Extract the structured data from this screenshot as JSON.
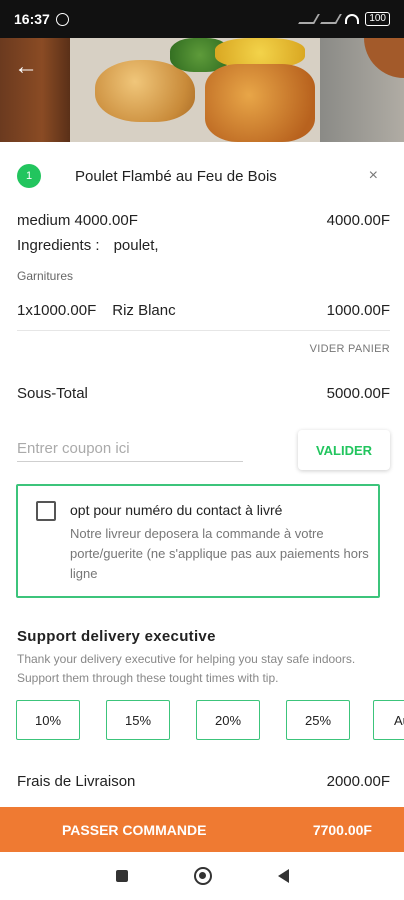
{
  "status_bar": {
    "time": "16:37",
    "battery": "100"
  },
  "cart": {
    "item_index": "1",
    "item_title": "Poulet Flambé au Feu de Bois",
    "size_line": "medium 4000.00F",
    "size_price": "4000.00F",
    "ingredients_label": "Ingredients :",
    "ingredients_value": "poulet,",
    "garnish_header": "Garnitures",
    "garnish_qty_price": "1x1000.00F",
    "garnish_name": "Riz Blanc",
    "garnish_price": "1000.00F",
    "empty_cart_label": "VIDER PANIER",
    "subtotal_label": "Sous-Total",
    "subtotal_value": "5000.00F"
  },
  "coupon": {
    "placeholder": "Entrer coupon ici",
    "validate_label": "VALIDER"
  },
  "contact_option": {
    "checked": false,
    "title": "opt pour numéro du contact à livré",
    "description": "Notre livreur deposera la commande à votre porte/guerite (ne s'applique pas aux paiements hors ligne"
  },
  "support": {
    "title": "Support delivery executive",
    "description": "Thank your delivery executive for helping you stay safe indoors. Support them through these tought times with tip.",
    "tips": [
      "10%",
      "15%",
      "20%",
      "25%"
    ],
    "tip_partial": "Au"
  },
  "delivery": {
    "label": "Frais de Livraison",
    "value": "2000.00F"
  },
  "order_bar": {
    "label": "PASSER COMMANDE",
    "total": "7700.00F",
    "color": "#ef7a32"
  },
  "colors": {
    "accent_green": "#22c55e",
    "border_green": "#3cc47b"
  }
}
